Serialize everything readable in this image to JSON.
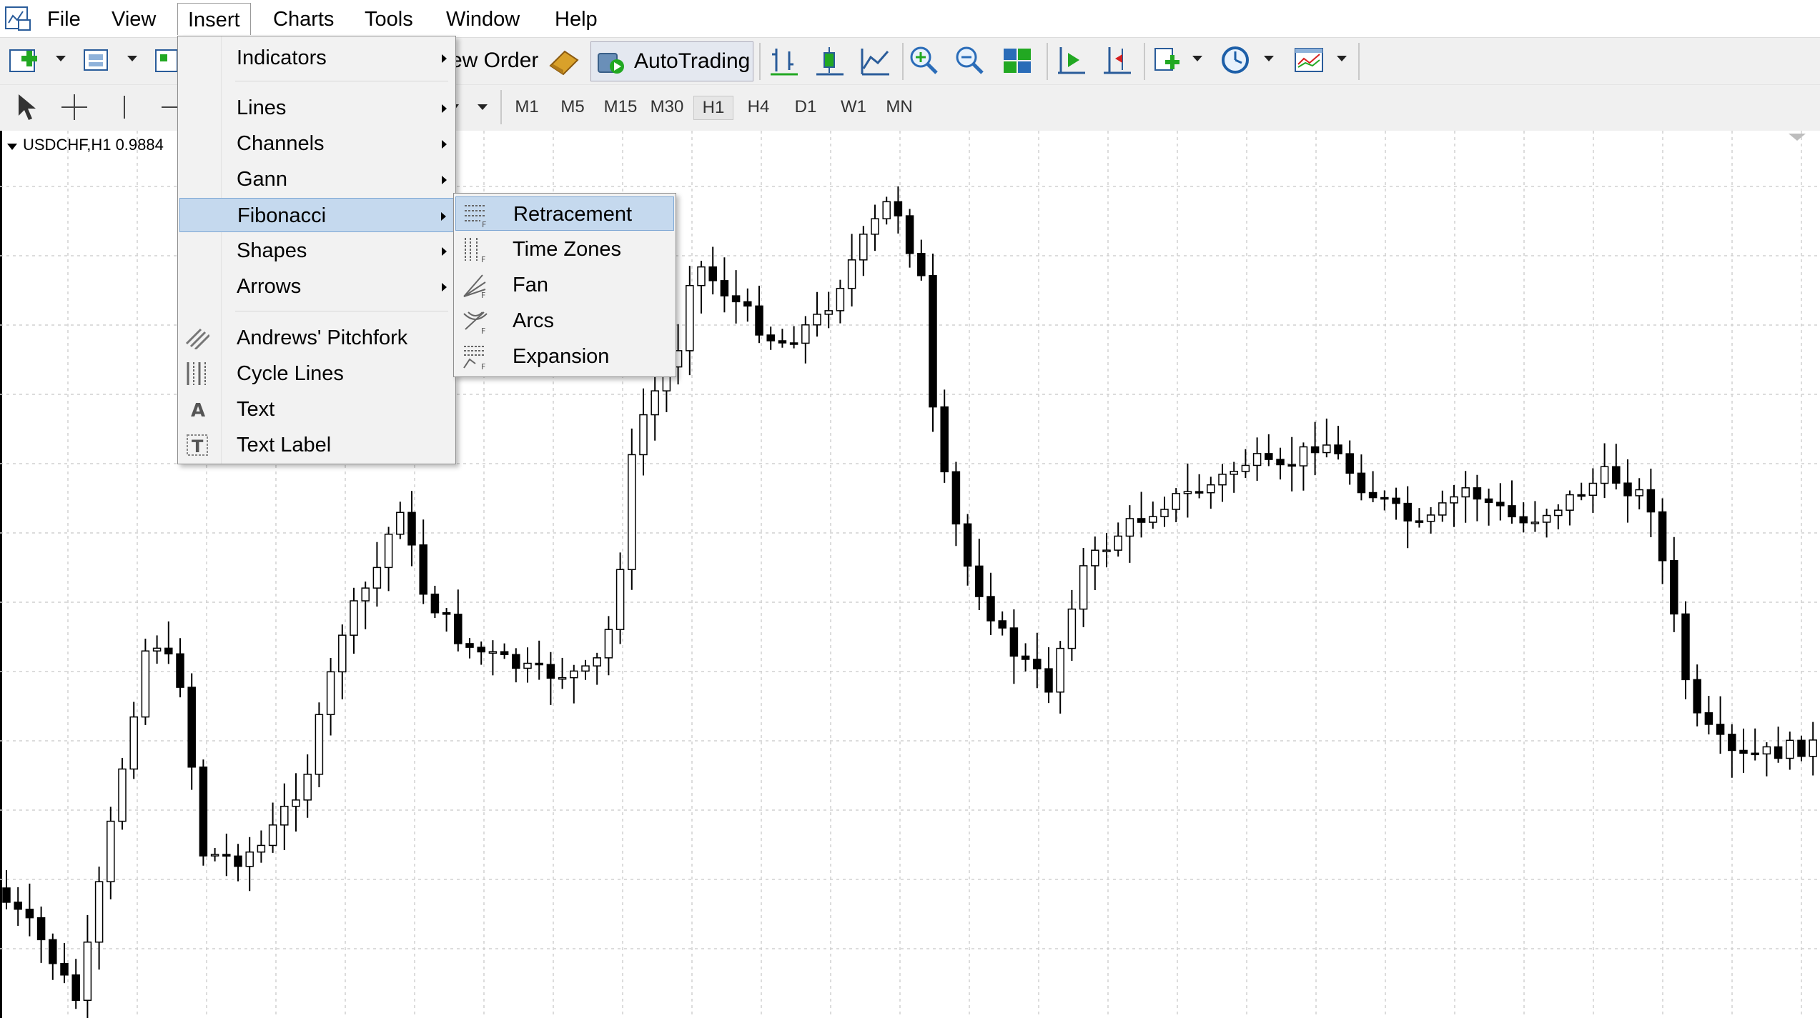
{
  "menubar": {
    "items": [
      {
        "label": "File"
      },
      {
        "label": "View"
      },
      {
        "label": "Insert"
      },
      {
        "label": "Charts"
      },
      {
        "label": "Tools"
      },
      {
        "label": "Window"
      },
      {
        "label": "Help"
      }
    ]
  },
  "toolbar": {
    "new_order_label": "ew Order",
    "autotrading_label": "AutoTrading"
  },
  "timeframes": [
    "M1",
    "M5",
    "M15",
    "M30",
    "H1",
    "H4",
    "D1",
    "W1",
    "MN"
  ],
  "active_timeframe": "H1",
  "chart": {
    "symbol_label": "USDCHF,H1  0.9884"
  },
  "insert_menu": {
    "items": [
      {
        "label": "Indicators",
        "submenu": true,
        "icon": ""
      },
      {
        "label": "Lines",
        "submenu": true,
        "icon": ""
      },
      {
        "label": "Channels",
        "submenu": true,
        "icon": ""
      },
      {
        "label": "Gann",
        "submenu": true,
        "icon": ""
      },
      {
        "label": "Fibonacci",
        "submenu": true,
        "icon": "",
        "highlighted": true
      },
      {
        "label": "Shapes",
        "submenu": true,
        "icon": ""
      },
      {
        "label": "Arrows",
        "submenu": true,
        "icon": ""
      },
      {
        "label": "Andrews' Pitchfork",
        "submenu": false,
        "icon": "pitchfork-icon"
      },
      {
        "label": "Cycle Lines",
        "submenu": false,
        "icon": "cycle-lines-icon"
      },
      {
        "label": "Text",
        "submenu": false,
        "icon": "text-icon"
      },
      {
        "label": "Text Label",
        "submenu": false,
        "icon": "text-label-icon"
      }
    ]
  },
  "fibonacci_menu": {
    "items": [
      {
        "label": "Retracement",
        "icon": "fib-retracement-icon",
        "highlighted": true
      },
      {
        "label": "Time Zones",
        "icon": "fib-time-zones-icon"
      },
      {
        "label": "Fan",
        "icon": "fib-fan-icon"
      },
      {
        "label": "Arcs",
        "icon": "fib-arcs-icon"
      },
      {
        "label": "Expansion",
        "icon": "fib-expansion-icon"
      }
    ]
  },
  "colors": {
    "menu_highlight": "#c5d9ee",
    "menu_highlight_border": "#7da7d4",
    "bull_candle": "#ffffff",
    "bear_candle": "#000000",
    "grid": "#d0d0d0"
  }
}
